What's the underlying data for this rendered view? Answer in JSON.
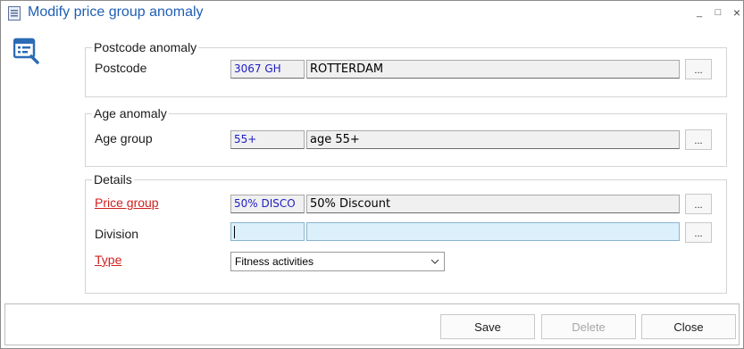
{
  "window": {
    "title": "Modify price group anomaly",
    "minimize": "_",
    "maximize": "□",
    "close": "×"
  },
  "postcode_group": {
    "legend": "Postcode anomaly",
    "label": "Postcode",
    "code": "3067 GH",
    "description": "ROTTERDAM",
    "browse": "..."
  },
  "age_group": {
    "legend": "Age anomaly",
    "label": "Age group",
    "code": "55+",
    "description": "age 55+",
    "browse": "..."
  },
  "details": {
    "legend": "Details",
    "price_group": {
      "label": "Price group",
      "code": "50% DISCO",
      "description": "50% Discount",
      "browse": "..."
    },
    "division": {
      "label": "Division",
      "code": "",
      "description": "",
      "browse": "..."
    },
    "type": {
      "label": "Type",
      "selected": "Fitness activities"
    }
  },
  "footer": {
    "save": "Save",
    "delete": "Delete",
    "close": "Close"
  },
  "colors": {
    "title": "#1f5fb4",
    "code_text": "#1d1dc4",
    "required_label": "#d11f1f",
    "edit_field_bg": "#dcf0fb",
    "icon_blue": "#2b6cb5"
  },
  "icons": {
    "title": "document-list-icon",
    "side": "edit-list-icon",
    "dropdown": "chevron-down-icon"
  }
}
